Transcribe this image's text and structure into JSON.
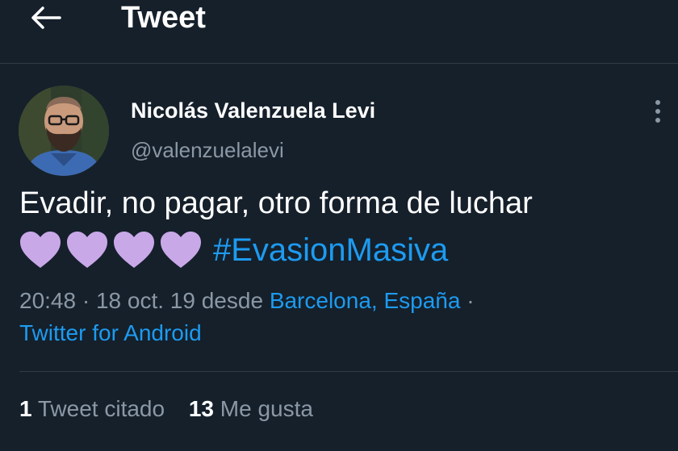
{
  "header": {
    "title": "Tweet",
    "back_icon": "arrow-left-icon"
  },
  "author": {
    "name": "Nicolás Valenzuela Levi",
    "handle": "@valenzuelalevi",
    "more_icon": "more-vertical-icon"
  },
  "tweet": {
    "text": "Evadir, no pagar, otro forma de luchar",
    "emoji": [
      "purple-heart-icon",
      "purple-heart-icon",
      "purple-heart-icon",
      "purple-heart-icon"
    ],
    "hashtag": "#EvasionMasiva"
  },
  "meta": {
    "time": "20:48",
    "sep1": " · ",
    "date": "18 oct. 19",
    "from": " desde ",
    "location": "Barcelona, España",
    "sep2": " · ",
    "source": "Twitter for Android"
  },
  "stats": {
    "quotes_count": "1",
    "quotes_label": "Tweet citado",
    "likes_count": "13",
    "likes_label": "Me gusta"
  },
  "colors": {
    "background": "#15202b",
    "link": "#1d9bf0",
    "secondary_text": "#8b98a5",
    "heart": "#c9a8e8"
  }
}
